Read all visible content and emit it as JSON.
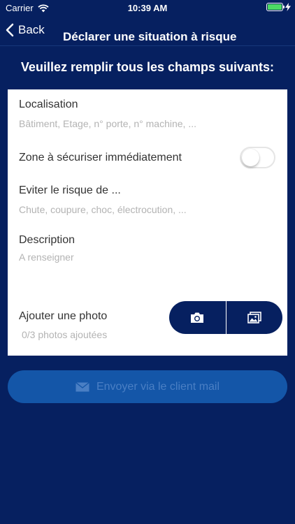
{
  "status_bar": {
    "carrier": "Carrier",
    "time": "10:39 AM",
    "battery_level": 1.0
  },
  "nav": {
    "back_label": "Back",
    "title": "Déclarer une situation à risque"
  },
  "instruction": "Veuillez remplir tous les champs suivants:",
  "form": {
    "location": {
      "label": "Localisation",
      "placeholder": "Bâtiment, Etage, n° porte, n° machine, ..."
    },
    "secure_zone": {
      "label": "Zone à sécuriser immédiatement",
      "on": false
    },
    "risk": {
      "label": "Eviter le risque de ...",
      "placeholder": "Chute, coupure, choc, électrocution, ..."
    },
    "description": {
      "label": "Description",
      "placeholder": "A renseigner"
    },
    "photo": {
      "label": "Ajouter une photo",
      "count_text": "0/3 photos ajoutées",
      "camera_icon": "camera-icon",
      "gallery_icon": "gallery-icon"
    }
  },
  "send_button": {
    "label": "Envoyer via le client mail",
    "icon": "envelope-icon"
  },
  "colors": {
    "background": "#062060",
    "card": "#ffffff",
    "button_dark": "#062060",
    "send_button_bg": "#1456a8",
    "send_button_text": "#4a7fc4",
    "battery": "#4cd964"
  }
}
